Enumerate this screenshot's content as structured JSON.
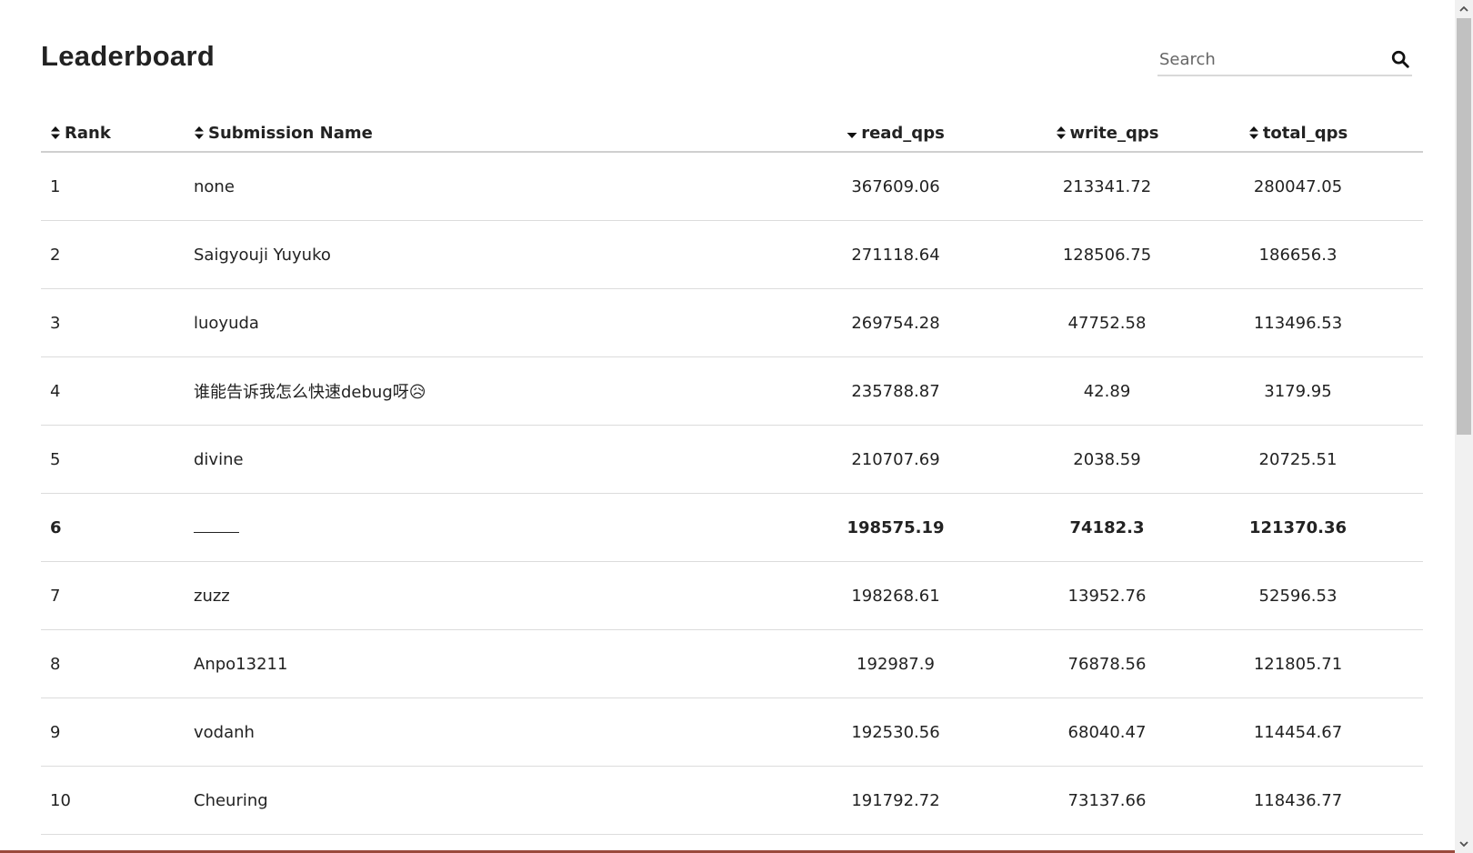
{
  "header": {
    "title": "Leaderboard",
    "search_placeholder": "Search",
    "search_value": ""
  },
  "table": {
    "columns": [
      {
        "key": "rank",
        "label": "Rank",
        "sort": "none"
      },
      {
        "key": "name",
        "label": "Submission Name",
        "sort": "none"
      },
      {
        "key": "read_qps",
        "label": "read_qps",
        "sort": "desc"
      },
      {
        "key": "write_qps",
        "label": "write_qps",
        "sort": "none"
      },
      {
        "key": "total_qps",
        "label": "total_qps",
        "sort": "none"
      }
    ],
    "rows": [
      {
        "rank": "1",
        "name": "none",
        "read_qps": "367609.06",
        "write_qps": "213341.72",
        "total_qps": "280047.05"
      },
      {
        "rank": "2",
        "name": "Saigyouji Yuyuko",
        "read_qps": "271118.64",
        "write_qps": "128506.75",
        "total_qps": "186656.3"
      },
      {
        "rank": "3",
        "name": "luoyuda",
        "read_qps": "269754.28",
        "write_qps": "47752.58",
        "total_qps": "113496.53"
      },
      {
        "rank": "4",
        "name": "谁能告诉我怎么快速debug呀😥",
        "read_qps": "235788.87",
        "write_qps": "42.89",
        "total_qps": "3179.95"
      },
      {
        "rank": "5",
        "name": "divine",
        "read_qps": "210707.69",
        "write_qps": "2038.59",
        "total_qps": "20725.51"
      },
      {
        "rank": "6",
        "name": "",
        "read_qps": "198575.19",
        "write_qps": "74182.3",
        "total_qps": "121370.36"
      },
      {
        "rank": "7",
        "name": "zuzz",
        "read_qps": "198268.61",
        "write_qps": "13952.76",
        "total_qps": "52596.53"
      },
      {
        "rank": "8",
        "name": "Anpo13211",
        "read_qps": "192987.9",
        "write_qps": "76878.56",
        "total_qps": "121805.71"
      },
      {
        "rank": "9",
        "name": "vodanh",
        "read_qps": "192530.56",
        "write_qps": "68040.47",
        "total_qps": "114454.67"
      },
      {
        "rank": "10",
        "name": "Cheuring",
        "read_qps": "191792.72",
        "write_qps": "73137.66",
        "total_qps": "118436.77"
      }
    ],
    "highlight_rank": "6"
  },
  "colors": {
    "text": "#222222",
    "divider": "#dcdcdc",
    "bottom_accent": "#9a4a3c"
  },
  "icons": {
    "search": "search-icon",
    "sort_both": "sort-both-icon",
    "sort_desc": "sort-desc-icon"
  }
}
